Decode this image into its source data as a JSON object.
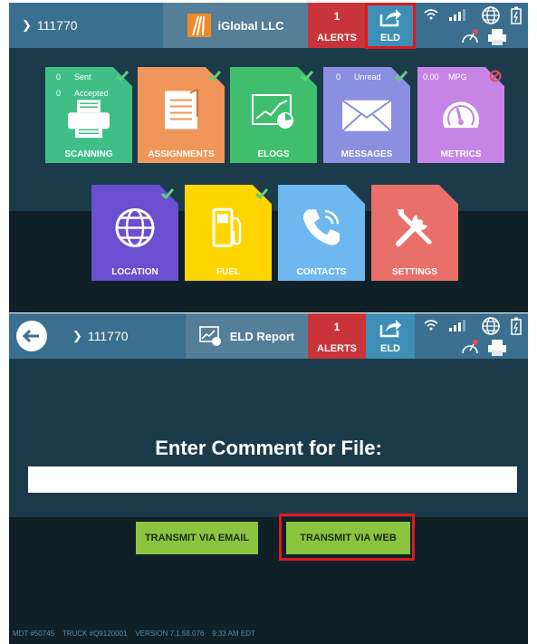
{
  "screen1": {
    "topbar": {
      "driver_id": "111770",
      "company": "iGlobal LLC",
      "alerts_count": "1",
      "alerts_label": "ALERTS",
      "eld_label": "ELD"
    },
    "tiles": [
      {
        "key": "scanning",
        "label": "SCANNING",
        "color": "#3fbf86",
        "stat1_num": "0",
        "stat1_label": "Sent",
        "stat2_num": "0",
        "stat2_label": "Accepted",
        "status": "check"
      },
      {
        "key": "assignments",
        "label": "ASSIGNMENTS",
        "color": "#f0965a",
        "status": "check"
      },
      {
        "key": "elogs",
        "label": "ELOGS",
        "color": "#3fbf6e",
        "status": "check"
      },
      {
        "key": "messages",
        "label": "MESSAGES",
        "color": "#8b8fe0",
        "stat1_num": "0",
        "stat1_label": "Unread",
        "status": "check"
      },
      {
        "key": "metrics",
        "label": "METRICS",
        "color": "#c685e6",
        "stat1_num": "0.00",
        "stat1_label": "MPG",
        "status": "blocked"
      },
      {
        "key": "location",
        "label": "LOCATION",
        "color": "#6a4fd0",
        "status": "check"
      },
      {
        "key": "fuel",
        "label": "FUEL",
        "color": "#ffd500",
        "status": "check"
      },
      {
        "key": "contacts",
        "label": "CONTACTS",
        "color": "#6fb8ef",
        "status": "none"
      },
      {
        "key": "settings",
        "label": "SETTINGS",
        "color": "#e86f6a",
        "status": "none"
      }
    ]
  },
  "screen2": {
    "topbar": {
      "driver_id": "111770",
      "title": "ELD Report",
      "alerts_count": "1",
      "alerts_label": "ALERTS",
      "eld_label": "ELD"
    },
    "prompt": "Enter Comment for File:",
    "comment_value": "",
    "email_button": "TRANSMIT VIA EMAIL",
    "web_button": "TRANSMIT VIA WEB",
    "footer": {
      "mdt": "MDT #50745",
      "truck": "TRUCK #Q9120001",
      "version": "VERSION  7.1.58.076",
      "time": "9:33 AM EDT"
    }
  },
  "colors": {
    "topbar": "#3b6f8f",
    "alerts": "#c9343a",
    "eld": "#3d8fb5",
    "check": "#5fd07a",
    "highlight": "#e0181e",
    "button": "#8bc540"
  }
}
